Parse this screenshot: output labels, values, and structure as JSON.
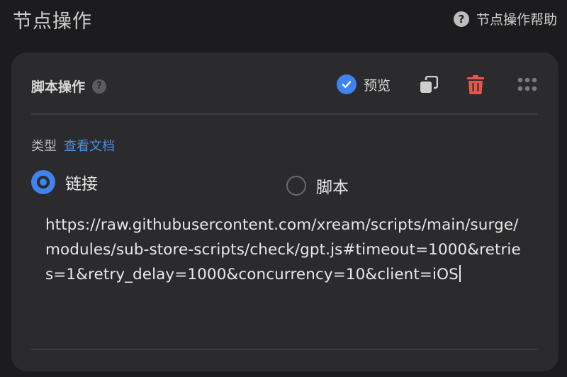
{
  "header": {
    "title": "节点操作",
    "help_label": "节点操作帮助",
    "help_icon": "question-circle-icon"
  },
  "card": {
    "title": "脚本操作",
    "title_help_icon": "question-circle-icon",
    "preview_label": "预览",
    "preview_checked": true,
    "actions": [
      "copy-icon",
      "trash-icon",
      "drag-handle-icon"
    ],
    "type_label": "类型",
    "docs_link": "查看文档",
    "options": [
      {
        "label": "链接",
        "selected": true
      },
      {
        "label": "脚本",
        "selected": false
      }
    ],
    "url_value": "https://raw.githubusercontent.com/xream/scripts/main/surge/modules/sub-store-scripts/check/gpt.js#timeout=1000&retries=1&retry_delay=1000&concurrency=10&client=iOS"
  },
  "colors": {
    "accent": "#3f82f0",
    "danger": "#e5574d",
    "background": "#1c1c1e",
    "card": "#2b2b2d"
  }
}
